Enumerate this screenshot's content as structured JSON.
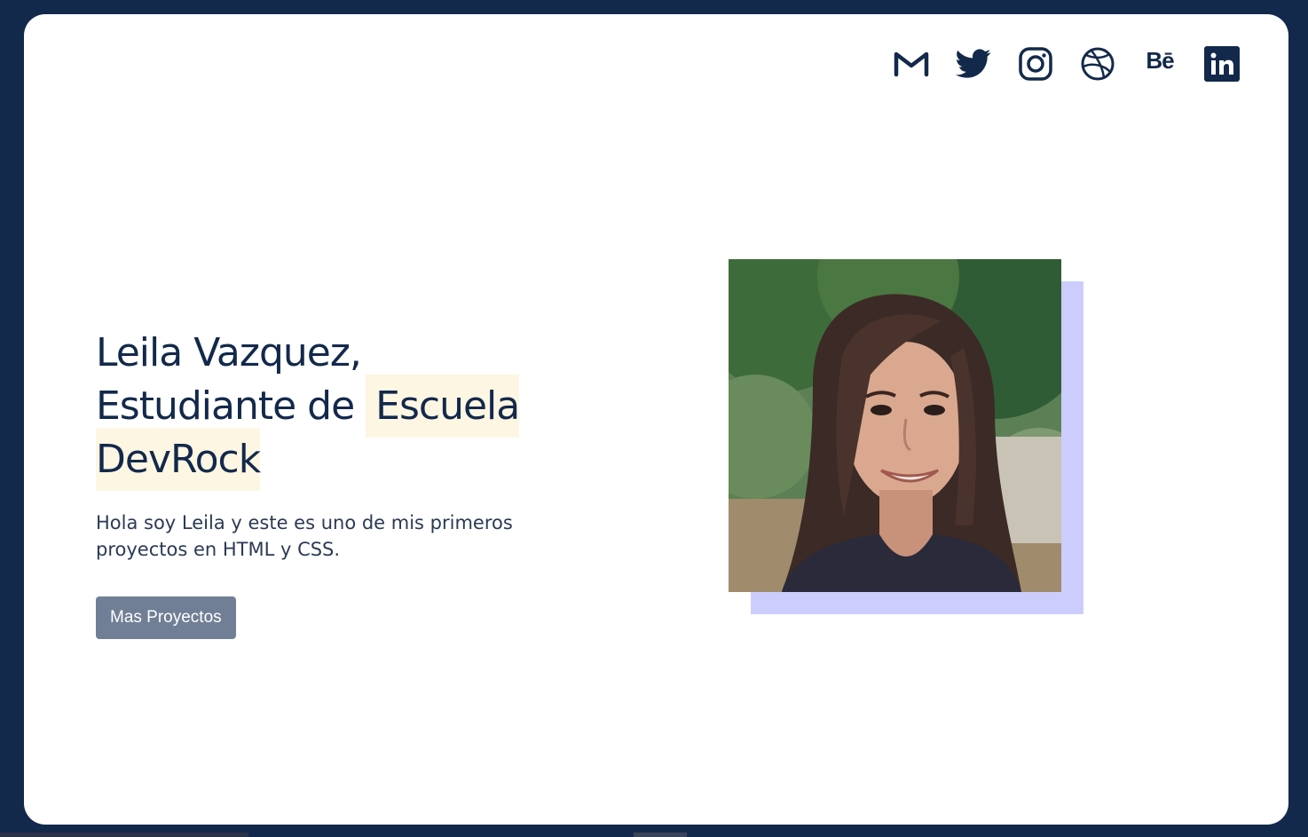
{
  "social": {
    "items": [
      {
        "name": "gmail",
        "icon": "gmail-icon"
      },
      {
        "name": "twitter",
        "icon": "twitter-icon"
      },
      {
        "name": "instagram",
        "icon": "instagram-icon"
      },
      {
        "name": "dribbble",
        "icon": "dribbble-icon"
      },
      {
        "name": "behance",
        "icon": "behance-icon",
        "text": "Bē"
      },
      {
        "name": "linkedin",
        "icon": "linkedin-icon"
      }
    ]
  },
  "hero": {
    "title_line1": "Leila Vazquez,",
    "title_line2_prefix": "Estudiante de ",
    "title_highlight_1": "Escuela",
    "title_highlight_2": "DevRock",
    "description": "Hola soy Leila y este es uno de mis primeros proyectos en HTML y CSS.",
    "button_label": "Mas Proyectos",
    "photo_alt": "profile-photo"
  },
  "colors": {
    "background": "#13294b",
    "card": "#ffffff",
    "text": "#13294b",
    "highlight": "#fdf6e3",
    "button": "#707f95",
    "photo_shadow": "#cccdfd"
  }
}
